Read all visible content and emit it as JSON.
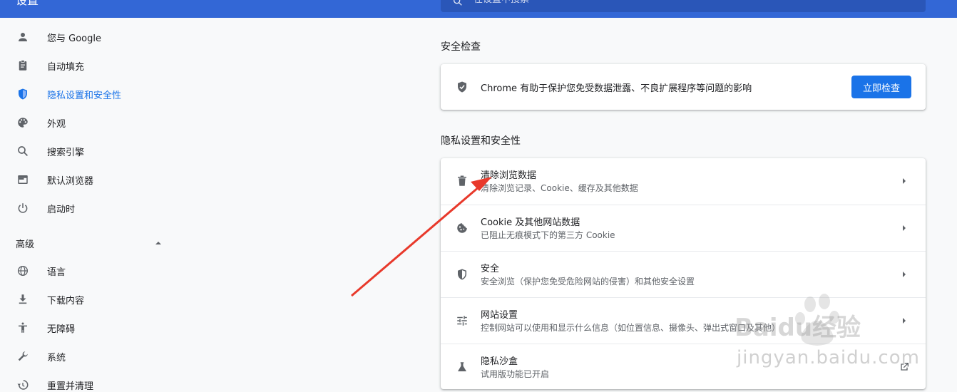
{
  "header": {
    "title": "设置",
    "search_placeholder": "在设置中搜索"
  },
  "sidebar": {
    "items": [
      {
        "label": "您与 Google",
        "icon": "person-icon",
        "active": false
      },
      {
        "label": "自动填充",
        "icon": "clipboard-icon",
        "active": false
      },
      {
        "label": "隐私设置和安全性",
        "icon": "shield-icon",
        "active": true
      },
      {
        "label": "外观",
        "icon": "palette-icon",
        "active": false
      },
      {
        "label": "搜索引擎",
        "icon": "search-icon",
        "active": false
      },
      {
        "label": "默认浏览器",
        "icon": "browser-icon",
        "active": false
      },
      {
        "label": "启动时",
        "icon": "power-icon",
        "active": false
      }
    ],
    "advanced_label": "高级",
    "advanced_items": [
      {
        "label": "语言",
        "icon": "globe-icon"
      },
      {
        "label": "下载内容",
        "icon": "download-icon"
      },
      {
        "label": "无障碍",
        "icon": "accessibility-icon"
      },
      {
        "label": "系统",
        "icon": "wrench-icon"
      },
      {
        "label": "重置并清理",
        "icon": "history-icon"
      }
    ]
  },
  "safety_check": {
    "title": "安全检查",
    "text": "Chrome 有助于保护您免受数据泄露、不良扩展程序等问题的影响",
    "button": "立即检查"
  },
  "privacy": {
    "title": "隐私设置和安全性",
    "rows": [
      {
        "title": "清除浏览数据",
        "subtitle": "清除浏览记录、Cookie、缓存及其他数据",
        "icon": "trash-icon"
      },
      {
        "title": "Cookie 及其他网站数据",
        "subtitle": "已阻止无痕模式下的第三方 Cookie",
        "icon": "cookie-icon"
      },
      {
        "title": "安全",
        "subtitle": "安全浏览（保护您免受危险网站的侵害）和其他安全设置",
        "icon": "shield-icon"
      },
      {
        "title": "网站设置",
        "subtitle": "控制网站可以使用和显示什么信息（如位置信息、摄像头、弹出式窗口及其他）",
        "icon": "tune-icon"
      },
      {
        "title": "隐私沙盒",
        "subtitle": "试用版功能已开启",
        "icon": "flask-icon"
      }
    ]
  },
  "watermark": {
    "brand": "Baidu经验",
    "url": "jingyan.baidu.com"
  },
  "colors": {
    "header": "#3367d6",
    "accent": "#1a73e8",
    "annotation_arrow": "#e8392b"
  }
}
